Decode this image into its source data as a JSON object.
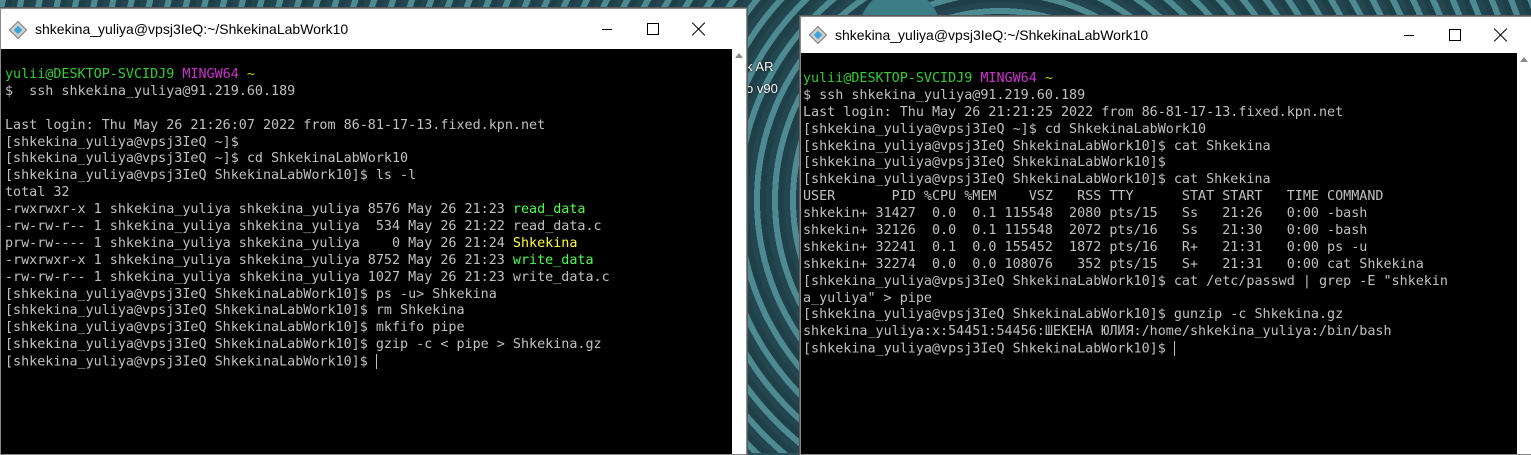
{
  "desktop": {
    "label_lines": [
      "k AR",
      "o v90"
    ]
  },
  "left_window": {
    "title": "shkekina_yuliya@vpsj3IeQ:~/ShkekinaLabWork10",
    "lines": [
      [
        {
          "t": "yulii@DESKTOP-SVCIDJ9 ",
          "c": "green"
        },
        {
          "t": "MINGW64 ",
          "c": "mag"
        },
        {
          "t": "~",
          "c": "yellow"
        }
      ],
      [
        {
          "t": "$  ssh shkekina_yuliya@91.219.60.189"
        }
      ],
      [
        {
          "t": ""
        }
      ],
      [
        {
          "t": "Last login: Thu May 26 21:26:07 2022 from 86-81-17-13.fixed.kpn.net"
        }
      ],
      [
        {
          "t": "[shkekina_yuliya@vpsj3IeQ ~]$"
        }
      ],
      [
        {
          "t": "[shkekina_yuliya@vpsj3IeQ ~]$ cd ShkekinaLabWork10"
        }
      ],
      [
        {
          "t": "[shkekina_yuliya@vpsj3IeQ ShkekinaLabWork10]$ ls -l"
        }
      ],
      [
        {
          "t": "total 32"
        }
      ],
      [
        {
          "t": "-rwxrwxr-x 1 shkekina_yuliya shkekina_yuliya 8576 May 26 21:23 "
        },
        {
          "t": "read_data",
          "c": "bgreen"
        }
      ],
      [
        {
          "t": "-rw-rw-r-- 1 shkekina_yuliya shkekina_yuliya  534 May 26 21:22 read_data.c"
        }
      ],
      [
        {
          "t": "prw-rw---- 1 shkekina_yuliya shkekina_yuliya    0 May 26 21:24 "
        },
        {
          "t": "Shkekina",
          "c": "byellow"
        }
      ],
      [
        {
          "t": "-rwxrwxr-x 1 shkekina_yuliya shkekina_yuliya 8752 May 26 21:23 "
        },
        {
          "t": "write_data",
          "c": "bgreen"
        }
      ],
      [
        {
          "t": "-rw-rw-r-- 1 shkekina_yuliya shkekina_yuliya 1027 May 26 21:23 write_data.c"
        }
      ],
      [
        {
          "t": "[shkekina_yuliya@vpsj3IeQ ShkekinaLabWork10]$ ps -u> Shkekina"
        }
      ],
      [
        {
          "t": "[shkekina_yuliya@vpsj3IeQ ShkekinaLabWork10]$ rm Shkekina"
        }
      ],
      [
        {
          "t": "[shkekina_yuliya@vpsj3IeQ ShkekinaLabWork10]$ mkfifo pipe"
        }
      ],
      [
        {
          "t": "[shkekina_yuliya@vpsj3IeQ ShkekinaLabWork10]$ gzip -c < pipe > Shkekina.gz"
        }
      ],
      [
        {
          "t": "[shkekina_yuliya@vpsj3IeQ ShkekinaLabWork10]$ "
        }
      ]
    ]
  },
  "right_window": {
    "title": "shkekina_yuliya@vpsj3IeQ:~/ShkekinaLabWork10",
    "lines": [
      [
        {
          "t": "yulii@DESKTOP-SVCIDJ9 ",
          "c": "green"
        },
        {
          "t": "MINGW64 ",
          "c": "mag"
        },
        {
          "t": "~",
          "c": "yellow"
        }
      ],
      [
        {
          "t": "$ ssh shkekina_yuliya@91.219.60.189"
        }
      ],
      [
        {
          "t": "Last login: Thu May 26 21:21:25 2022 from 86-81-17-13.fixed.kpn.net"
        }
      ],
      [
        {
          "t": "[shkekina_yuliya@vpsj3IeQ ~]$ cd ShkekinaLabWork10"
        }
      ],
      [
        {
          "t": "[shkekina_yuliya@vpsj3IeQ ShkekinaLabWork10]$ cat Shkekina"
        }
      ],
      [
        {
          "t": "[shkekina_yuliya@vpsj3IeQ ShkekinaLabWork10]$"
        }
      ],
      [
        {
          "t": "[shkekina_yuliya@vpsj3IeQ ShkekinaLabWork10]$ cat Shkekina"
        }
      ],
      [
        {
          "t": "USER       PID %CPU %MEM    VSZ   RSS TTY      STAT START   TIME COMMAND"
        }
      ],
      [
        {
          "t": "shkekin+ 31427  0.0  0.1 115548  2080 pts/15   Ss   21:26   0:00 -bash"
        }
      ],
      [
        {
          "t": "shkekin+ 32126  0.0  0.1 115548  2072 pts/16   Ss   21:30   0:00 -bash"
        }
      ],
      [
        {
          "t": "shkekin+ 32241  0.1  0.0 155452  1872 pts/16   R+   21:31   0:00 ps -u"
        }
      ],
      [
        {
          "t": "shkekin+ 32274  0.0  0.0 108076   352 pts/15   S+   21:31   0:00 cat Shkekina"
        }
      ],
      [
        {
          "t": "[shkekina_yuliya@vpsj3IeQ ShkekinaLabWork10]$ cat /etc/passwd | grep -E \"shkekin"
        }
      ],
      [
        {
          "t": "a_yuliya\" > pipe"
        }
      ],
      [
        {
          "t": "[shkekina_yuliya@vpsj3IeQ ShkekinaLabWork10]$ gunzip -c Shkekina.gz"
        }
      ],
      [
        {
          "t": "shkekina_yuliya:x:54451:54456:ШЕКЕНА ЮЛИЯ:/home/shkekina_yuliya:/bin/bash"
        }
      ],
      [
        {
          "t": "[shkekina_yuliya@vpsj3IeQ ShkekinaLabWork10]$ "
        }
      ]
    ]
  },
  "colors": {
    "green": "#33cc33",
    "mag": "#cc33cc",
    "yellow": "#c7c700",
    "bgreen": "#4cff4c",
    "byellow": "#ffff33"
  },
  "icons": {
    "app": "git-bash-icon",
    "minimize": "minimize-icon",
    "maximize": "maximize-icon",
    "close": "close-icon"
  }
}
